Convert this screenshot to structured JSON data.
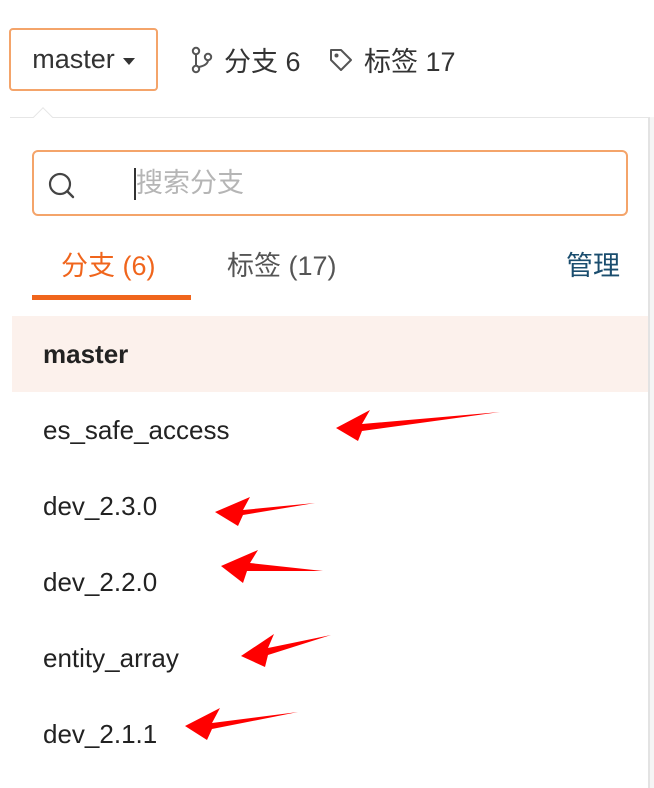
{
  "toolbar": {
    "branch_selector": "master",
    "branches_label": "分支 6",
    "tags_label": "标签 17"
  },
  "search": {
    "placeholder": "搜索分支",
    "value": ""
  },
  "tabs": {
    "branches": "分支 (6)",
    "tags": "标签 (17)",
    "manage": "管理",
    "active": "branches"
  },
  "branches": [
    {
      "name": "master",
      "selected": true
    },
    {
      "name": "es_safe_access",
      "selected": false
    },
    {
      "name": "dev_2.3.0",
      "selected": false
    },
    {
      "name": "dev_2.2.0",
      "selected": false
    },
    {
      "name": "entity_array",
      "selected": false
    },
    {
      "name": "dev_2.1.1",
      "selected": false
    }
  ],
  "colors": {
    "accent": "#f0651c",
    "focus_border": "#f4a46a",
    "active_row_bg": "#fcf1ec",
    "manage_link": "#1a4d6e",
    "annotation_arrow": "#ff0000"
  },
  "icons": {
    "branch_count": "git-branch-icon",
    "tag_count": "tag-icon",
    "search": "search-icon",
    "dropdown": "caret-down-icon"
  }
}
